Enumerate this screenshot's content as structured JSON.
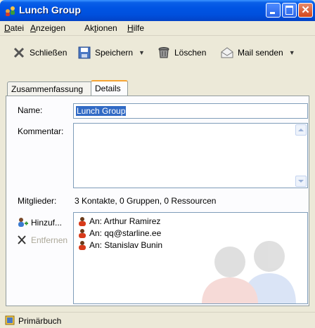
{
  "window": {
    "title": "Lunch Group"
  },
  "menu": [
    {
      "pre": "",
      "key": "D",
      "post": "atei"
    },
    {
      "pre": "",
      "key": "A",
      "post": "nzeigen"
    },
    {
      "pre": "Ak",
      "key": "t",
      "post": "ionen"
    },
    {
      "pre": "",
      "key": "H",
      "post": "ilfe"
    }
  ],
  "toolbar": {
    "close_label": "Schließen",
    "save_label": "Speichern",
    "delete_label": "Löschen",
    "mail_label": "Mail senden"
  },
  "tabs": {
    "summary": "Zusammenfassung",
    "details": "Details"
  },
  "form": {
    "name_label": "Name:",
    "name_value": "Lunch Group",
    "comment_label": "Kommentar:",
    "comment_value": "",
    "members_label": "Mitglieder:",
    "members_summary": "3 Kontakte, 0 Gruppen, 0 Ressourcen"
  },
  "actions": {
    "add_label": "Hinzuf...",
    "remove_label": "Entfernen"
  },
  "members": [
    {
      "name": "An: Arthur Ramirez"
    },
    {
      "name": "An: qq@starline.ee"
    },
    {
      "name": "An: Stanislav Bunin"
    }
  ],
  "status": {
    "text": "Primärbuch"
  },
  "colors": {
    "title_bar": "#0054e3",
    "selection": "#316ac5",
    "active_tab_accent": "#f5a433"
  }
}
